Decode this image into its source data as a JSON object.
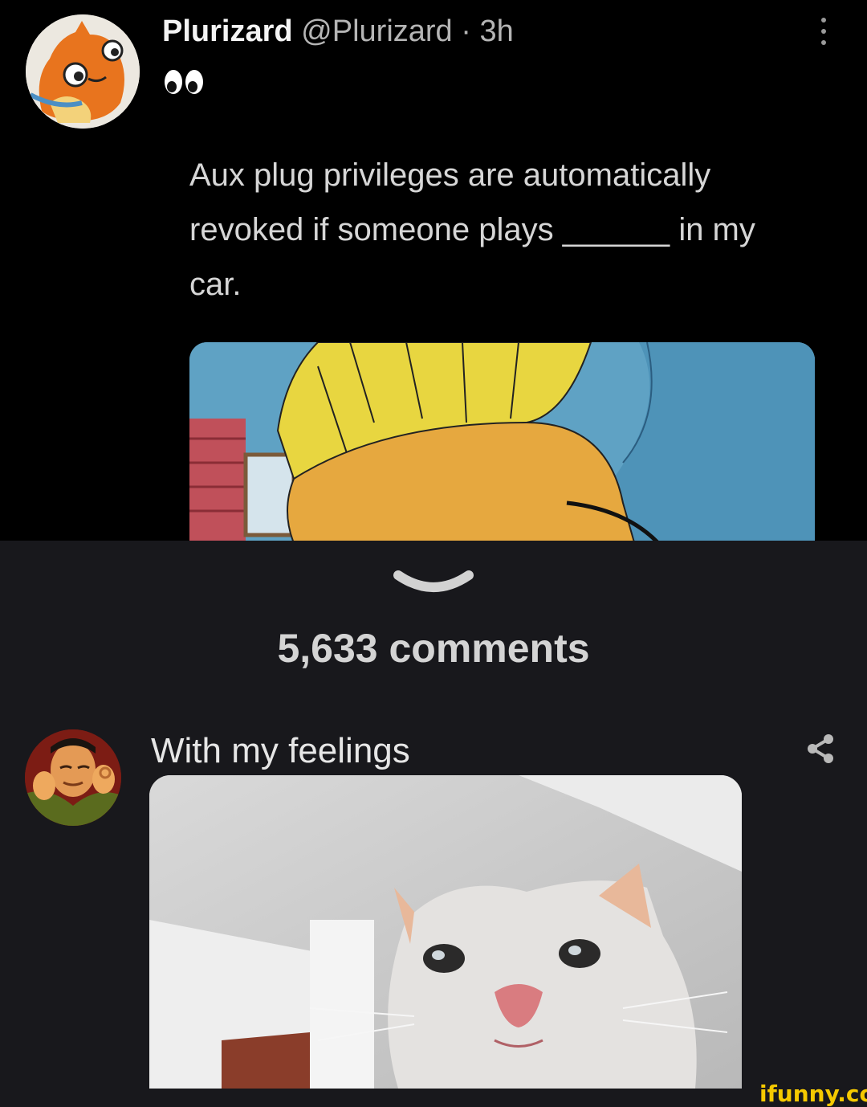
{
  "tweet": {
    "display_name": "Plurizard",
    "handle": "@Plurizard",
    "separator": "·",
    "time": "3h",
    "emoji": "👀",
    "text_line1": "Aux plug privileges are automatically",
    "text_line2_start": "revoked if someone plays",
    "blank": "______",
    "text_line2_end": "in my",
    "text_line3": "car."
  },
  "comments": {
    "count_label": "5,633 comments"
  },
  "comment": {
    "text": "With my feelings"
  },
  "watermark": {
    "text": "ifunny.co"
  },
  "colors": {
    "tweet_bg": "#000000",
    "app_bg": "#18181c",
    "watermark": "#f5c900"
  },
  "icons": [
    "more-vertical-icon",
    "chevron-down-icon",
    "share-icon"
  ]
}
